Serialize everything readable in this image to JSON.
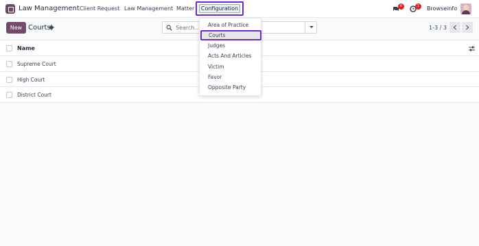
{
  "app": {
    "title": "Law Management"
  },
  "nav": {
    "items": [
      "Client Request",
      "Law Management",
      "Matter"
    ],
    "configuration": "Configuration"
  },
  "systray": {
    "messages_count": "6",
    "activities_count": "1",
    "company": "Browseinfo"
  },
  "control_panel": {
    "new_label": "New",
    "breadcrumb": "Courts",
    "search_placeholder": "Search...",
    "pager": "1-3 / 3"
  },
  "list": {
    "columns": [
      "Name"
    ],
    "rows": [
      "Supreme Court",
      "High Court",
      "District Court"
    ]
  },
  "configuration_menu": {
    "items": [
      "Area of Practice",
      "Courts",
      "Judges",
      "Acts And Articles",
      "Victim",
      "Favor",
      "Opposite Party"
    ],
    "selected": "Courts"
  },
  "colors": {
    "brand": "#714b67",
    "highlight_border": "#6d28d9",
    "badge": "#dc2626"
  }
}
